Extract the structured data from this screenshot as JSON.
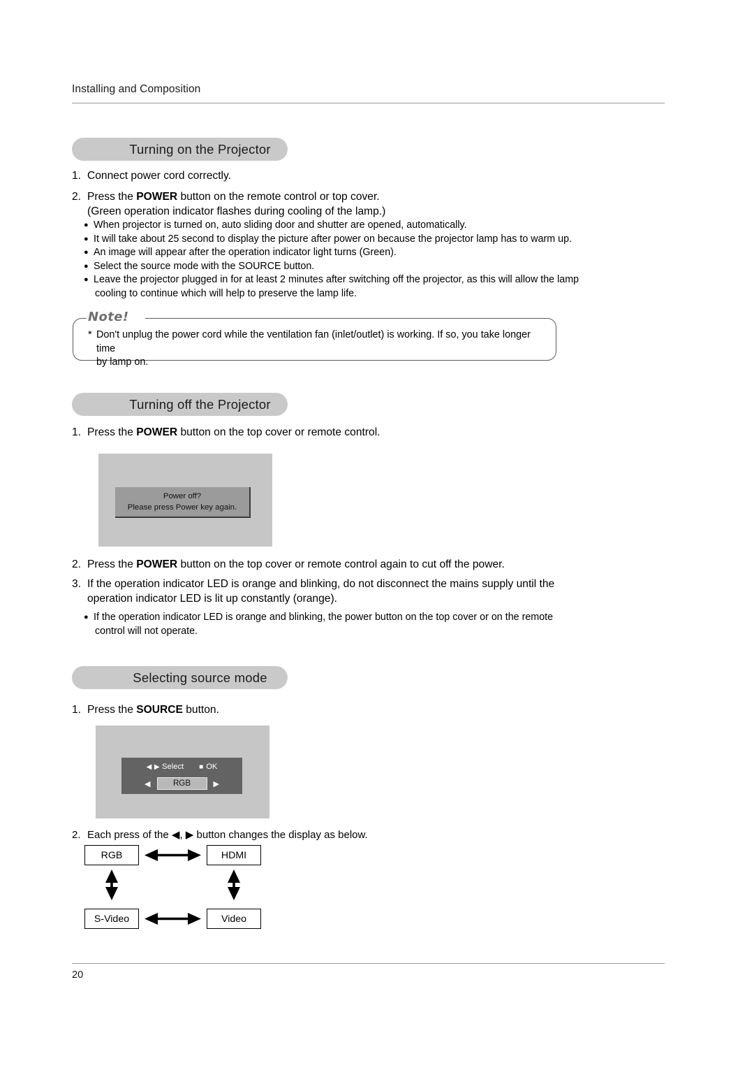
{
  "page": {
    "running_header": "Installing and Composition",
    "page_number": "20"
  },
  "sections": {
    "turning_on": {
      "title": "Turning on the Projector",
      "steps": [
        {
          "num": "1.",
          "parts": [
            {
              "t": "Connect power cord correctly.",
              "b": false
            }
          ]
        },
        {
          "num": "2.",
          "parts": [
            {
              "t": "Press the ",
              "b": false
            },
            {
              "t": "POWER",
              "b": true
            },
            {
              "t": " button on the remote control or top cover.",
              "b": false
            }
          ],
          "line2": "(Green operation indicator flashes during cooling of the lamp.)"
        }
      ],
      "bullets": [
        {
          "l1": "When projector is turned on, auto sliding door and shutter are opened, automatically."
        },
        {
          "l1": "It will take about 25 second to display the picture after power on because the projector lamp has to warm up."
        },
        {
          "l1": "An image will appear after the operation indicator light turns (Green)."
        },
        {
          "l1": "Select the source mode with the SOURCE button."
        },
        {
          "l1": "Leave the projector plugged in for at least 2 minutes after switching off the projector, as this will allow the lamp",
          "l2": "cooling to continue which will help to preserve the lamp life."
        }
      ]
    },
    "note": {
      "label": "Note!",
      "marker": "*",
      "line1": "Don't unplug the power cord while the ventilation fan (inlet/outlet) is working. If so, you take longer time",
      "line2": "by lamp on."
    },
    "turning_off": {
      "title": "Turning off the Projector",
      "step1": {
        "num": "1.",
        "parts": [
          {
            "t": "Press the ",
            "b": false
          },
          {
            "t": "POWER",
            "b": true
          },
          {
            "t": " button on the top cover or remote control.",
            "b": false
          }
        ]
      },
      "osd": {
        "line1": "Power off?",
        "line2": "Please press Power key again."
      },
      "step2": {
        "num": "2.",
        "parts": [
          {
            "t": "Press the ",
            "b": false
          },
          {
            "t": "POWER",
            "b": true
          },
          {
            "t": " button on the top cover or remote control again to cut off the power.",
            "b": false
          }
        ]
      },
      "step3": {
        "num": "3.",
        "line1": "If the operation indicator LED is orange and blinking, do not disconnect the mains supply until the",
        "line2": "operation indicator LED is lit up constantly (orange)."
      },
      "bullets": [
        {
          "l1": "If the operation indicator LED is  orange and blinking, the power button on the top cover or on the remote",
          "l2": "control will not operate."
        }
      ]
    },
    "selecting_source": {
      "title": "Selecting source mode",
      "step1": {
        "num": "1.",
        "parts": [
          {
            "t": "Press the ",
            "b": false
          },
          {
            "t": "SOURCE",
            "b": true
          },
          {
            "t": " button.",
            "b": false
          }
        ]
      },
      "osd": {
        "left_arrow": "◀",
        "right_arrow": "▶",
        "select_label": "Select",
        "ok_square": "■",
        "ok_label": "OK",
        "selected_source": "RGB"
      },
      "step2": {
        "num": "2.",
        "pre": "Each press of the ",
        "left_arrow": "◀",
        "comma": ", ",
        "right_arrow": "▶",
        "post": " button changes the display as below."
      },
      "flow": {
        "rgb": "RGB",
        "hdmi": "HDMI",
        "svideo": "S-Video",
        "video": "Video"
      }
    }
  },
  "colors": {
    "pill_gray": "#c9c9c9",
    "screen_gray": "#c6c6c6",
    "osd_dark": "#636363",
    "osd_mid": "#9b9b9b",
    "rule_gray": "#9a9a9a"
  }
}
